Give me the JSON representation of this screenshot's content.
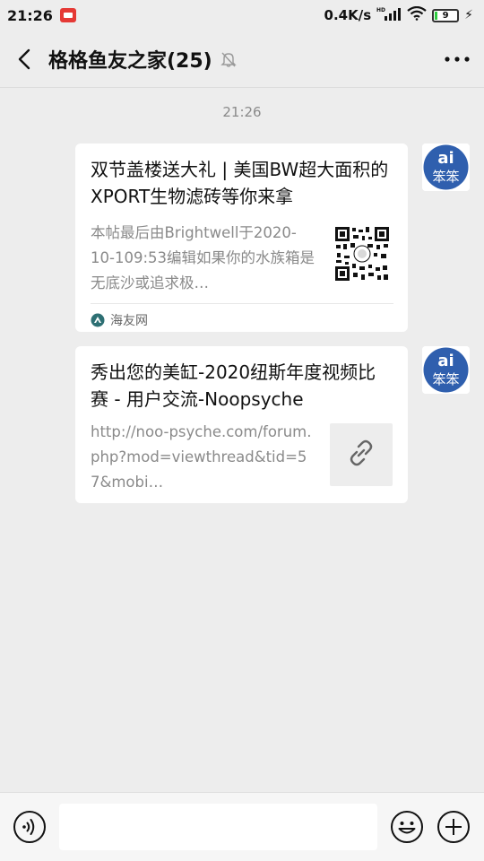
{
  "status_bar": {
    "time": "21:26",
    "net_speed": "0.4K/s",
    "network": "HD",
    "battery": "9"
  },
  "header": {
    "title": "格格鱼友之家(25)"
  },
  "chat": {
    "timestamp": "21:26",
    "messages": [
      {
        "title": "双节盖楼送大礼 | 美国BW超大面积的XPORT生物滤砖等你来拿",
        "desc": "本帖最后由Brightwell于2020-10-109:53编辑如果你的水族箱是无底沙或追求极…",
        "source": "海友网"
      },
      {
        "title": "秀出您的美缸-2020纽斯年度视频比赛 - 用户交流-Noopsyche",
        "desc": "http://noo-psyche.com/forum.php?mod=viewthread&tid=57&mobi…"
      }
    ]
  },
  "colors": {
    "background": "#ededed",
    "card": "#ffffff",
    "muted_text": "#8a8a8a",
    "avatar_blue": "#2f5fae",
    "avatar_text": "#ffffff"
  },
  "icons": {
    "back": "chevron-left-icon",
    "mute": "bell-off-icon",
    "more": "more-dots-icon",
    "voice": "voice-icon",
    "emoji": "emoji-icon",
    "plus": "plus-icon",
    "link": "link-icon",
    "source": "source-icon"
  }
}
